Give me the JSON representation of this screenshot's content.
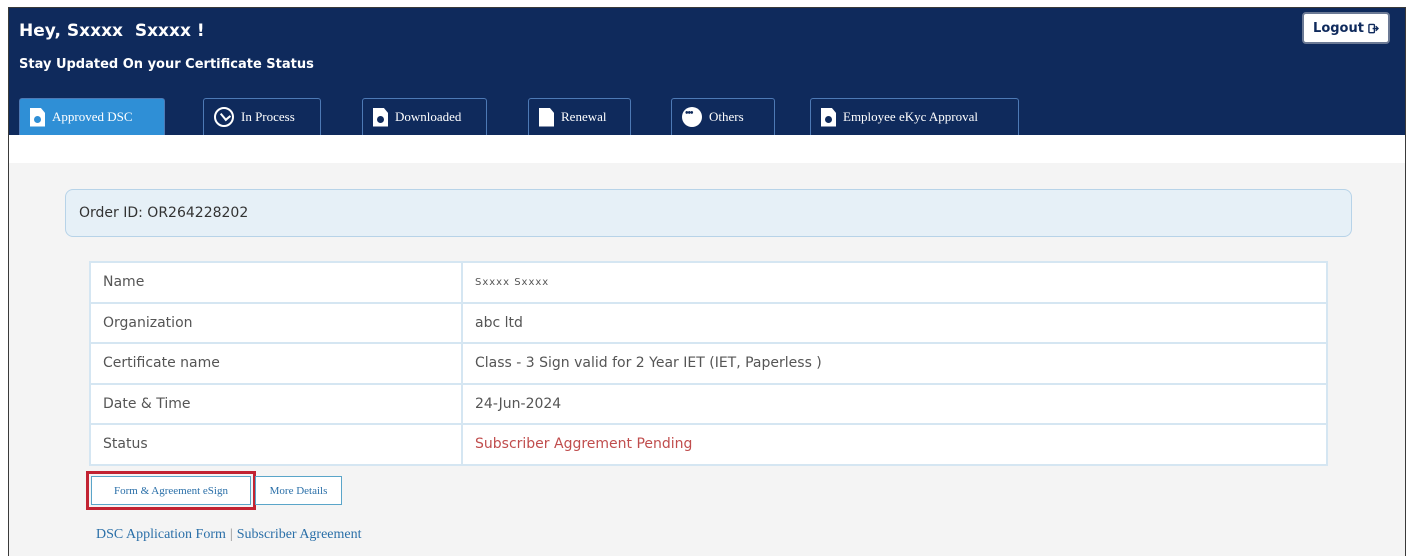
{
  "header": {
    "greeting": "Hey, Sxxxx  Sxxxx !",
    "subtitle": "Stay Updated On your Certificate Status",
    "logout_label": "Logout",
    "logout_icon": "logout-icon"
  },
  "tabs": [
    {
      "label": "Approved DSC",
      "icon": "document-icon",
      "active": true
    },
    {
      "label": "In Process",
      "icon": "clock-icon",
      "active": false
    },
    {
      "label": "Downloaded",
      "icon": "document-icon",
      "active": false
    },
    {
      "label": "Renewal",
      "icon": "document-icon",
      "active": false
    },
    {
      "label": "Others",
      "icon": "more-dots-icon",
      "active": false
    },
    {
      "label": "Employee eKyc Approval",
      "icon": "document-icon",
      "active": false
    }
  ],
  "order": {
    "label": "Order ID: OR264228202"
  },
  "details": [
    {
      "label": "Name",
      "value": "Sxxxx  Sxxxx"
    },
    {
      "label": "Organization",
      "value": "abc ltd"
    },
    {
      "label": "Certificate name",
      "value": "Class - 3 Sign valid for 2 Year IET (IET, Paperless )"
    },
    {
      "label": "Date & Time",
      "value": "24-Jun-2024"
    },
    {
      "label": "Status",
      "value": "Subscriber Aggrement Pending"
    }
  ],
  "actions": {
    "esign_label": "Form & Agreement eSign",
    "more_details_label": "More Details"
  },
  "links": {
    "application_form": "DSC Application Form",
    "separator": "|",
    "subscriber_agreement": "Subscriber Agreement"
  },
  "colors": {
    "header_bg": "#0f2a5c",
    "active_tab": "#2f8fd6",
    "status_text": "#c04d4d",
    "highlight": "#c22332"
  }
}
